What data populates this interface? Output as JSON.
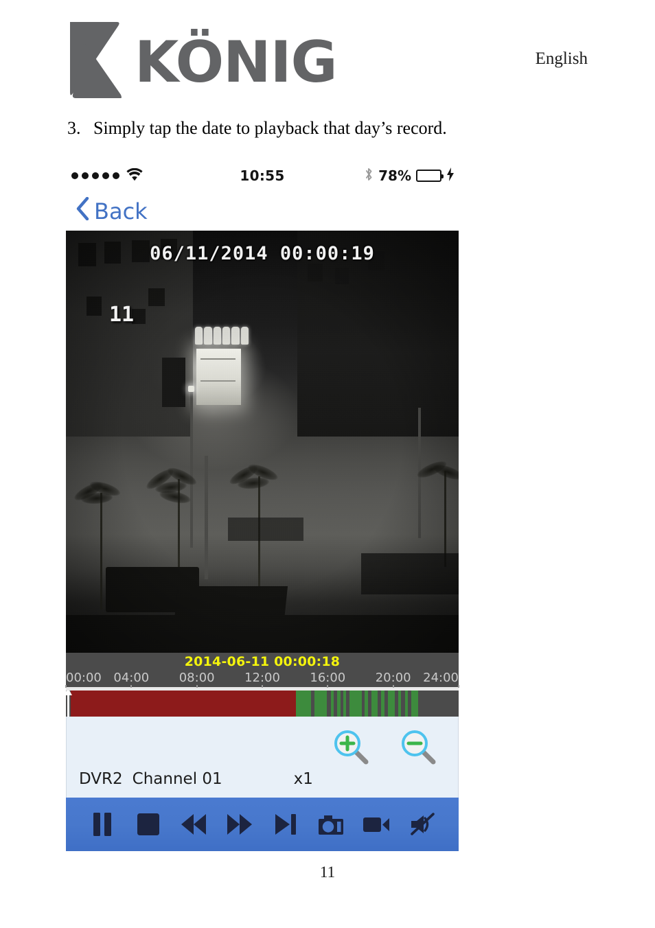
{
  "header": {
    "brand": "KÖNIG",
    "language": "English",
    "logo_icon": "konig-k-logo"
  },
  "instruction": {
    "number": "3.",
    "text": "Simply tap the date to playback that day’s record."
  },
  "phone": {
    "status_bar": {
      "signal_dots": 5,
      "wifi_icon": "wifi-icon",
      "time": "10:55",
      "bluetooth_icon": "bluetooth-icon",
      "battery_percent": "78%",
      "battery_level": 78,
      "battery_color": "#4ecb5c",
      "charging_icon": "lightning-bolt-icon"
    },
    "nav": {
      "back_label": "Back",
      "back_icon": "chevron-left-icon",
      "accent_color": "#4272c4"
    },
    "video": {
      "osd_timestamp": "06/11/2014 00:00:19",
      "osd_channel": "11",
      "description": "night-time black-and-white CCTV view of a street with a lit shopfront, lamp posts and palm trees"
    },
    "timeline": {
      "current_timestamp": "2014-06-11 00:00:18",
      "timestamp_color": "#f4f40c",
      "tick_labels": [
        "00:00",
        "04:00",
        "08:00",
        "12:00",
        "16:00",
        "20:00",
        "24:00"
      ],
      "playhead_position_percent": 0.3,
      "segments": [
        {
          "type": "continuous",
          "color": "#8d1b1b",
          "start_percent": 1.2,
          "end_percent": 58.5
        },
        {
          "type": "motion",
          "color": "#3d8b3d",
          "start_percent": 58.5,
          "end_percent": 62.5
        },
        {
          "type": "motion",
          "color": "#3d8b3d",
          "start_percent": 63.3,
          "end_percent": 66.4
        },
        {
          "type": "motion",
          "color": "#3d8b3d",
          "start_percent": 67.4,
          "end_percent": 68.1
        },
        {
          "type": "motion",
          "color": "#3d8b3d",
          "start_percent": 69.0,
          "end_percent": 69.9
        },
        {
          "type": "motion",
          "color": "#3d8b3d",
          "start_percent": 70.7,
          "end_percent": 71.4
        },
        {
          "type": "motion",
          "color": "#3d8b3d",
          "start_percent": 72.2,
          "end_percent": 75.3
        },
        {
          "type": "motion",
          "color": "#3d8b3d",
          "start_percent": 76.1,
          "end_percent": 77.0
        },
        {
          "type": "motion",
          "color": "#3d8b3d",
          "start_percent": 77.8,
          "end_percent": 79.4
        },
        {
          "type": "motion",
          "color": "#3d8b3d",
          "start_percent": 80.3,
          "end_percent": 81.1
        },
        {
          "type": "motion",
          "color": "#3d8b3d",
          "start_percent": 82.0,
          "end_percent": 83.8
        },
        {
          "type": "motion",
          "color": "#3d8b3d",
          "start_percent": 84.7,
          "end_percent": 85.4
        },
        {
          "type": "motion",
          "color": "#3d8b3d",
          "start_percent": 86.3,
          "end_percent": 87.1
        },
        {
          "type": "motion",
          "color": "#3d8b3d",
          "start_percent": 88.0,
          "end_percent": 89.6
        }
      ]
    },
    "info": {
      "dvr_name": "DVR2",
      "channel": "Channel 01",
      "speed": "x1",
      "zoom_in_icon": "magnifier-plus-icon",
      "zoom_out_icon": "magnifier-minus-icon",
      "panel_color": "#e8f0f8"
    },
    "controls": {
      "bar_color": "#4878cc",
      "buttons": [
        {
          "name": "pause-button",
          "icon": "pause-icon"
        },
        {
          "name": "stop-button",
          "icon": "stop-icon"
        },
        {
          "name": "rewind-button",
          "icon": "rewind-icon"
        },
        {
          "name": "fast-forward-button",
          "icon": "fast-forward-icon"
        },
        {
          "name": "next-frame-button",
          "icon": "next-frame-icon"
        },
        {
          "name": "snapshot-button",
          "icon": "camera-icon"
        },
        {
          "name": "record-button",
          "icon": "camcorder-icon"
        },
        {
          "name": "mute-button",
          "icon": "speaker-mute-icon"
        }
      ]
    }
  },
  "footer": {
    "page_number": "11"
  }
}
